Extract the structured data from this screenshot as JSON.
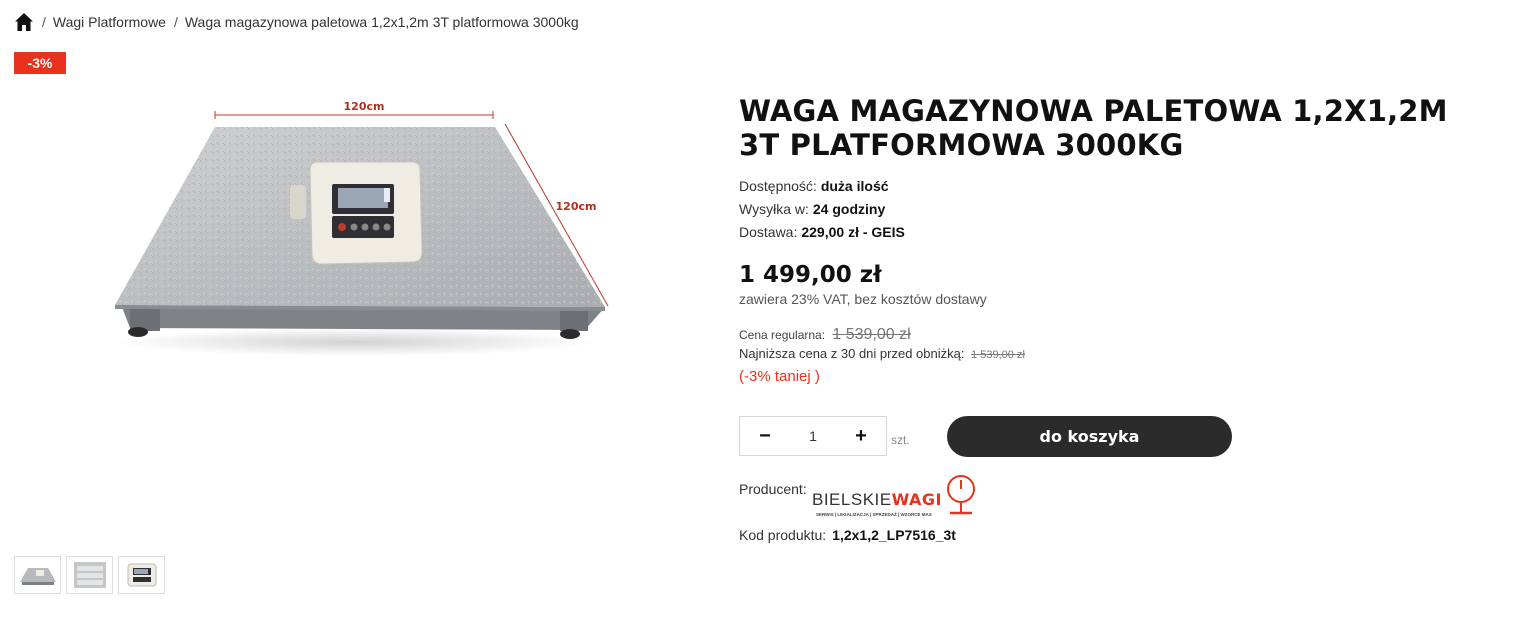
{
  "breadcrumb": {
    "home_icon": "home-icon",
    "items": [
      "Wagi Platformowe",
      "Waga magazynowa paletowa 1,2x1,2m 3T platformowa 3000kg"
    ]
  },
  "badge": {
    "label": "-3%",
    "color": "#e8321e"
  },
  "image": {
    "dim_top": "120cm",
    "dim_right": "120cm"
  },
  "product": {
    "title": "Waga magazynowa paletowa 1,2x1,2m 3T platformowa 3000kg",
    "availability_label": "Dostępność:",
    "availability_value": "duża ilość",
    "shipping_label": "Wysyłka w:",
    "shipping_value": "24 godziny",
    "delivery_label": "Dostawa:",
    "delivery_value": "229,00 zł - GEIS",
    "price": "1 499,00 zł",
    "price_note": "zawiera 23% VAT, bez kosztów dostawy",
    "regular_label": "Cena regularna:",
    "regular_price": "1 539,00 zł",
    "lowest_label": "Najniższa cena z 30 dni przed obniżką:",
    "lowest_price": "1 539,00 zł",
    "cheaper": "(-3% taniej )",
    "quantity": "1",
    "unit": "szt.",
    "add_to_cart": "do koszyka",
    "producer_label": "Producent:",
    "producer_brand_a": "BIELSKIE",
    "producer_brand_b": "WAGI",
    "producer_tagline": "SERWIS | LEGALIZACJA | SPRZEDAŻ | WZORCE MAS",
    "code_label": "Kod produktu:",
    "code_value": "1,2x1,2_LP7516_3t"
  },
  "colors": {
    "accent": "#e8321e",
    "button": "#2b2b2b"
  }
}
